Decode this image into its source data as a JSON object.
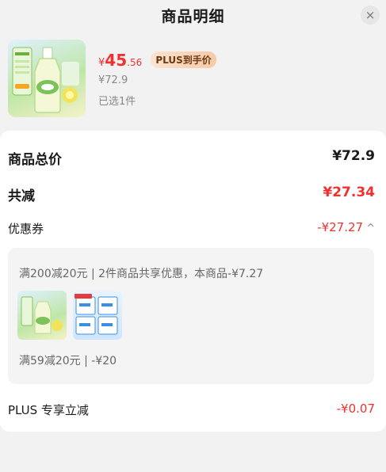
{
  "header": {
    "title": "商品明细",
    "close_glyph": "×"
  },
  "product": {
    "price_currency": "¥",
    "price_integer": "45",
    "price_decimal": ".56",
    "plus_badge": "PLUS到手价",
    "original_price": "¥72.9",
    "selected_count": "已选1件"
  },
  "summary": {
    "total_label": "商品总价",
    "total_value": "¥72.9",
    "discount_label": "共减",
    "discount_value": "¥27.34",
    "coupon_label": "优惠券",
    "coupon_value": "-¥27.27",
    "plus_label": "PLUS 专享立减",
    "plus_value": "-¥0.07"
  },
  "coupon_detail": {
    "line1": "满200减20元 | 2件商品共享优惠，本商品-¥7.27",
    "line2": "满59减20元 | -¥20"
  },
  "colors": {
    "accent": "#f23030",
    "background": "#f2f2f2",
    "card": "#ffffff",
    "panel": "#f4f4f4"
  }
}
